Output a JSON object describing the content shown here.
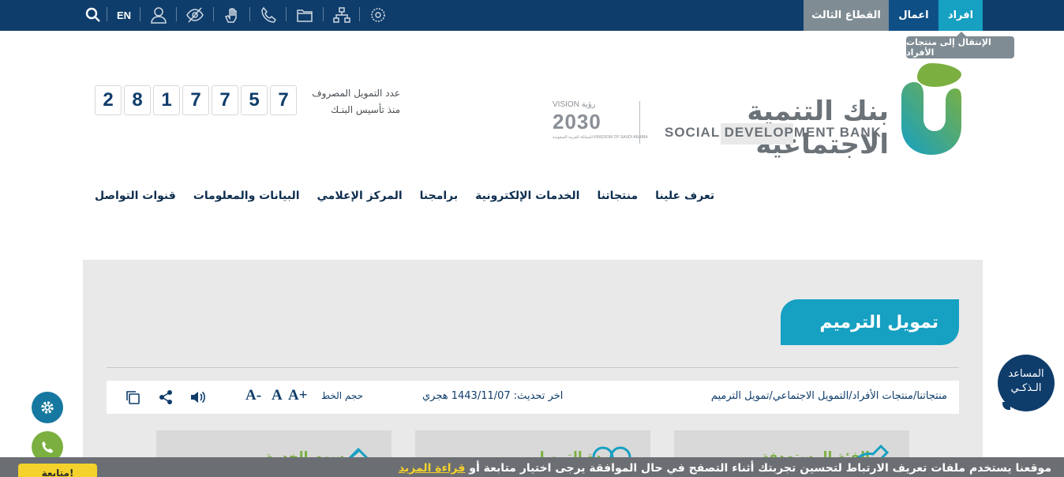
{
  "topbar": {
    "tabs": [
      {
        "label": "افراد",
        "state": "active"
      },
      {
        "label": "اعمال"
      },
      {
        "label": "القطاع الثالث"
      }
    ],
    "tooltip": "الإنتقال إلى منتجات الأفراد",
    "tools": [
      {
        "icon": "saudi-emblem-icon"
      },
      {
        "icon": "sitemap-icon"
      },
      {
        "icon": "folder-icon"
      },
      {
        "icon": "phone-icon"
      },
      {
        "icon": "sign-language-icon"
      },
      {
        "icon": "eye-slash-icon"
      },
      {
        "icon": "user-icon"
      },
      {
        "label": "EN"
      },
      {
        "icon": "search-icon"
      }
    ]
  },
  "header": {
    "bank_name_ar": "بنك التنمية الاجتماعية",
    "bank_name_en": "SOCIAL DEVELOPMENT BANK",
    "vision": {
      "top": "VISION رؤية",
      "year": "2030",
      "sub": "المملكة العربية السعودية KINGDOM OF SAUDI ARABIA"
    },
    "counter_label_line1": "عدد التمويل المصروف",
    "counter_label_line2": "منذ تأسيس البنـك",
    "counter_digits": [
      "7",
      "5",
      "7",
      "7",
      "1",
      "8",
      "2"
    ]
  },
  "nav": {
    "items": [
      "تعرف علينا",
      "منتجاتنا",
      "الخدمات الإلكترونية",
      "برامجنا",
      "المركز الإعلامي",
      "البيانات والمعلومات",
      "قنوات التواصل"
    ]
  },
  "content": {
    "title": "تمويل الترميم",
    "breadcrumb": "منتجاتنا/منتجات الأفراد/التمويل الاجتماعي/تمويل الترميم",
    "last_update": "اخر تحديث: 1443/11/07 هجري",
    "font_size_label": "حجم الخط",
    "font_buttons": [
      "A+",
      "A",
      "A-"
    ],
    "cards": [
      {
        "label": "الفئة المستهدفة",
        "icon": "target-group-icon"
      },
      {
        "label": "مدة التمويل",
        "icon": "duration-icon"
      },
      {
        "label": "رسوم الخدمة",
        "icon": "service-fees-icon"
      }
    ]
  },
  "floating": {
    "assistant_line1": "المساعد",
    "assistant_line2": "الـذكـي"
  },
  "cookie": {
    "text": "موقعنا يستخدم ملفات تعريف الارتباط لتحسين تجربتك أثناء التصفح في حال الموافقة يرجى اختيار متابعة أو",
    "more": "قراءة المزيد",
    "button": "متابعة!"
  },
  "colors": {
    "navy": "#0f3d6b",
    "teal": "#16a0c2",
    "green": "#7bb041",
    "grey": "#7f8c94",
    "yellow": "#f4d22b"
  }
}
